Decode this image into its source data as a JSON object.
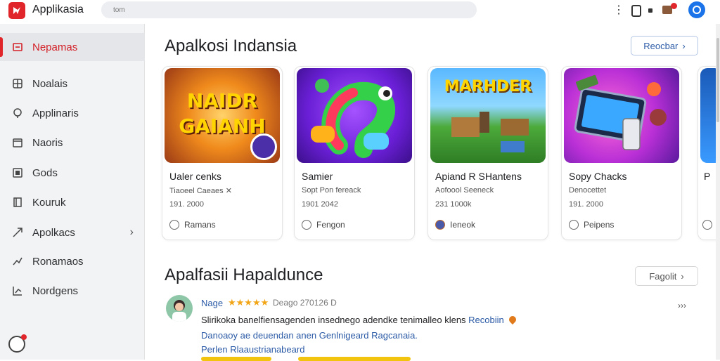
{
  "app": {
    "title": "Applikasia"
  },
  "search": {
    "placeholder": "tom"
  },
  "colors": {
    "brand": "#e0252b",
    "link": "#2b5aa6",
    "star": "#f2a516"
  },
  "top_icons": [
    "more-vert-icon",
    "device-icon",
    "gift-icon",
    "profile-icon"
  ],
  "sidebar": {
    "items": [
      {
        "label": "Nepamas",
        "icon": "home-icon",
        "active": true
      },
      {
        "label": "Noalais",
        "icon": "grid-icon"
      },
      {
        "label": "Applinaris",
        "icon": "pin-icon"
      },
      {
        "label": "Naoris",
        "icon": "calendar-icon"
      },
      {
        "label": "Gods",
        "icon": "library-icon"
      },
      {
        "label": "Kouruk",
        "icon": "book-icon"
      },
      {
        "label": "Apolkacs",
        "icon": "send-icon",
        "chevron": true
      },
      {
        "label": "Ronamaos",
        "icon": "trend-icon"
      },
      {
        "label": "Nordgens",
        "icon": "chart-icon"
      }
    ]
  },
  "section1": {
    "title": "Apalkosi Indansia",
    "button": "Reocbar",
    "cards": [
      {
        "thumb_text_1": "NAIDR",
        "thumb_text_2": "GAIANH",
        "title": "Ualer cenks",
        "sub": "Tiaoeel Caeaes ✕",
        "meta": "191. 2000",
        "foot": "Ramans"
      },
      {
        "thumb_text_1": "",
        "thumb_text_2": "",
        "title": "Samier",
        "sub": "Sopt Pon fereack",
        "meta": "1901 2042",
        "foot": "Fengon"
      },
      {
        "thumb_text_1": "MARHDER",
        "thumb_text_2": "",
        "title": "Apiand R SHantens",
        "sub": "Aofoool Seeneck",
        "meta": "231 1000k",
        "foot": "Ieneok"
      },
      {
        "thumb_text_1": "",
        "thumb_text_2": "",
        "title": "Sopy Chacks",
        "sub": "Denocettet",
        "meta": "191. 2000",
        "foot": "Peipens"
      },
      {
        "thumb_text_1": "",
        "thumb_text_2": "",
        "title": "P",
        "sub": "",
        "meta": "",
        "foot": ""
      }
    ]
  },
  "section2": {
    "title": "Apalfasii Hapaldunce",
    "button": "Fagolit",
    "review": {
      "name": "Nage",
      "stars": "★★★★★",
      "date": "Deago 270126 D",
      "more": "›››",
      "line1": "Slirikoka banelfiensagenden insednego adendke tenimalleo klens ",
      "line1_link": "Recobiin",
      "line2": "Danoaoy ae deuendan anen Genlnigeard Ragcanaia.",
      "line3": "Perlen Rlaaustrianabeard"
    }
  }
}
